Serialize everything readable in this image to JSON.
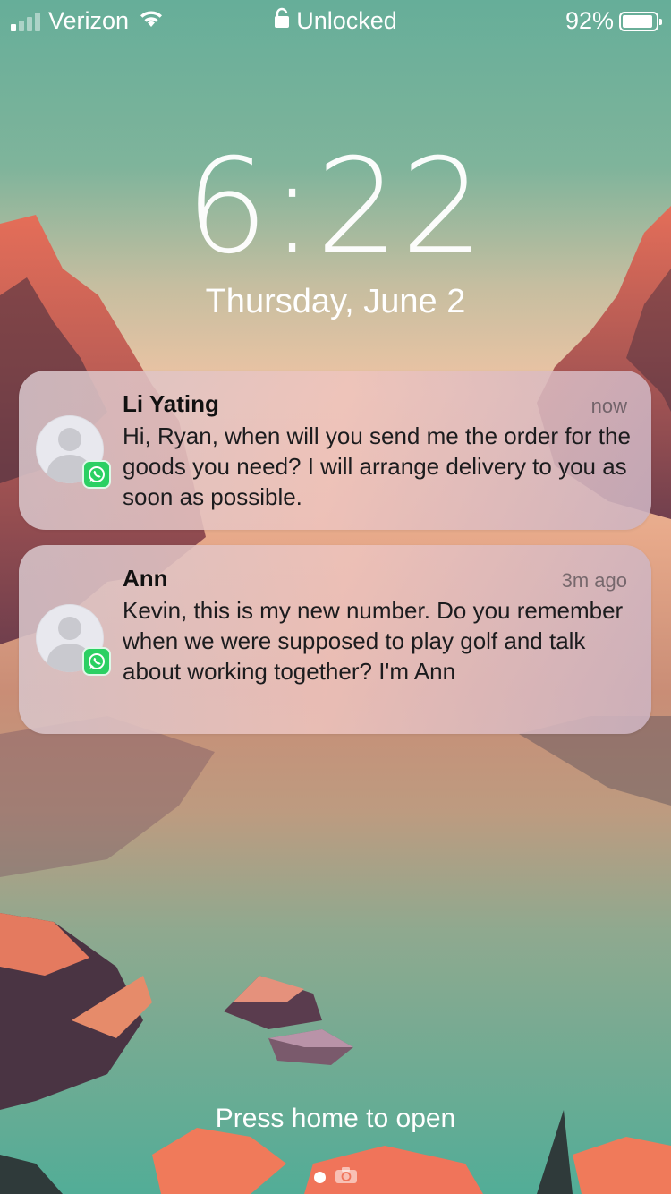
{
  "status_bar": {
    "carrier": "Verizon",
    "lock_status": "Unlocked",
    "battery": "92%",
    "battery_level": 0.92,
    "signal_bars": 1,
    "icons": [
      "signal-bars-icon",
      "wifi-icon",
      "lock-icon",
      "battery-icon"
    ]
  },
  "lock_screen": {
    "time": "6:22",
    "date": "Thursday, June 2"
  },
  "notifications": [
    {
      "sender": "Li Yating",
      "time": "now",
      "message": "Hi, Ryan, when will you send me the order for the goods you need? I will arrange delivery to you as soon as possible.",
      "app_icon": "whatsapp-icon"
    },
    {
      "sender": "Ann",
      "time": "3m ago",
      "message": "Kevin, this is my new number. Do you remember when we were supposed to play golf and talk about working together? I'm Ann",
      "app_icon": "whatsapp-icon"
    }
  ],
  "footer": {
    "hint": "Press home to open",
    "page_indicator": [
      "page-dot",
      "camera-icon"
    ]
  },
  "colors": {
    "whatsapp": "#2bd063",
    "wallpaper_top": "#6fae9a",
    "wallpaper_sky": "#e9c2a2"
  }
}
